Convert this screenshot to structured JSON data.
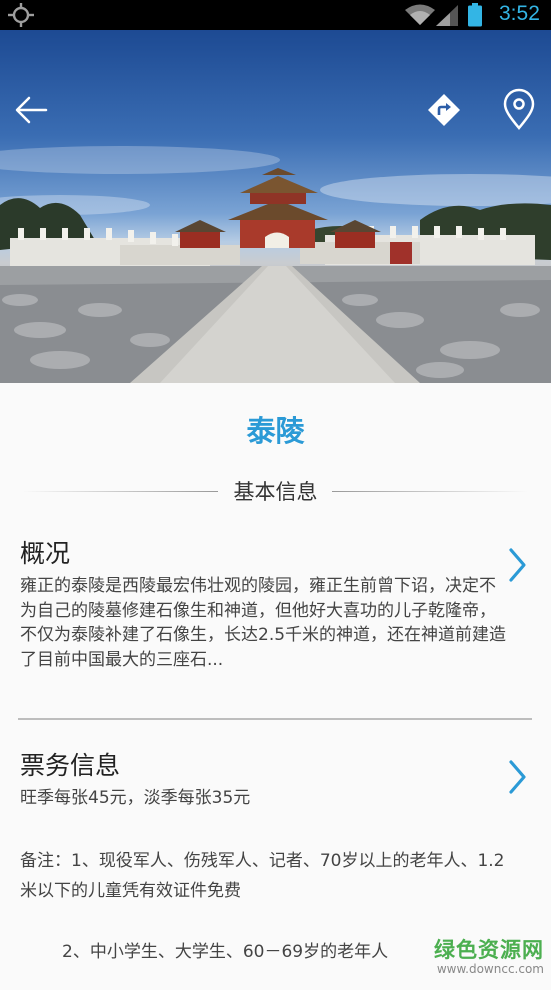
{
  "status_bar": {
    "time": "3:52",
    "icons": [
      "gps-icon",
      "wifi-icon",
      "signal-icon",
      "battery-icon"
    ],
    "accent_color": "#33b5e5"
  },
  "hero": {
    "image_alt": "泰陵",
    "actions": [
      "back-arrow-icon",
      "directions-icon",
      "location-pin-icon"
    ]
  },
  "page_title": "泰陵",
  "section_title": "基本信息",
  "overview": {
    "heading": "概况",
    "text": "雍正的泰陵是西陵最宏伟壮观的陵园，雍正生前曾下诏，决定不为自己的陵墓修建石像生和神道，但他好大喜功的儿子乾隆帝，不仅为泰陵补建了石像生，长达2.5千米的神道，还在神道前建造了目前中国最大的三座石..."
  },
  "tickets": {
    "heading": "票务信息",
    "price_text": "旺季每张45元，淡季每张35元",
    "note1": "备注：1、现役军人、伤残军人、记者、70岁以上的老年人、1.2米以下的儿童凭有效证件免费",
    "note2": "2、中小学生、大学生、60－69岁的老年人"
  },
  "watermark": {
    "name": "绿色资源网",
    "url": "www.downcc.com"
  },
  "colors": {
    "title_blue": "#2b9ad6",
    "chevron_blue": "#2b9ad6",
    "divider": "#bdbdbd"
  }
}
